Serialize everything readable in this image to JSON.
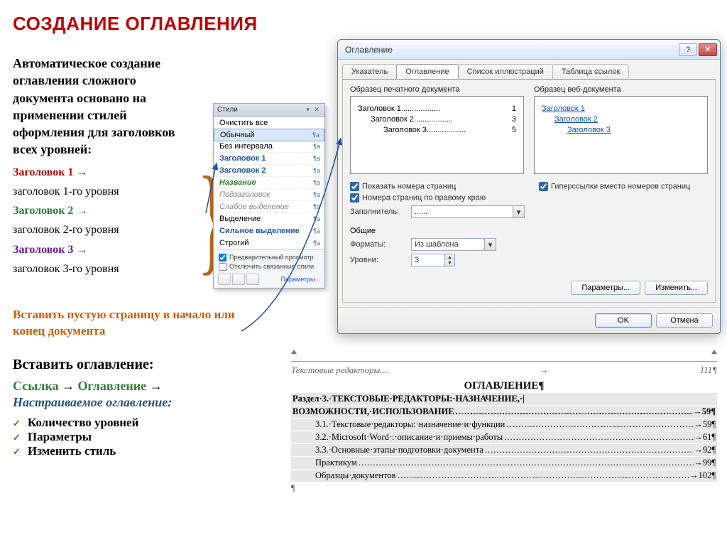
{
  "title": "СОЗДАНИЕ ОГЛАВЛЕНИЯ",
  "intro": "Автоматическое создание оглавления сложного документа основано на применении стилей оформления для заголовков всех уровней:",
  "hlist": {
    "h1": "Заголовок 1 →",
    "h1d": "заголовок 1-го уровня",
    "h2": "Заголовок 2 →",
    "h2d": "заголовок 2-го уровня",
    "h3": "Заголовок 3 →",
    "h3d": "заголовок 3-го уровня"
  },
  "orange": "Вставить пустую страницу  в начало или  конец документа",
  "insert": "Вставить оглавление:",
  "path": {
    "link": "Ссылка",
    "arrow": "→",
    "toc": "Оглавление"
  },
  "custom": "Настраиваемое оглавление:",
  "checks": [
    "Количество уровней",
    "Параметры",
    "Изменить стиль"
  ],
  "stylesPane": {
    "title": "Стили",
    "clear": "Очистить все",
    "rows": [
      {
        "name": "Обычный",
        "cls": "sel"
      },
      {
        "name": "Без интервала",
        "cls": ""
      },
      {
        "name": "Заголовок 1",
        "cls": "blue"
      },
      {
        "name": "Заголовок 2",
        "cls": "blue"
      },
      {
        "name": "Название",
        "cls": "green2"
      },
      {
        "name": "Подзаголовок",
        "cls": "italic-grey"
      },
      {
        "name": "Слабое выделение",
        "cls": "italic-grey"
      },
      {
        "name": "Выделение",
        "cls": ""
      },
      {
        "name": "Сильное выделение",
        "cls": "blue"
      },
      {
        "name": "Строгий",
        "cls": ""
      }
    ],
    "cbPreview": "Предварительный просмотр",
    "cbLinked": "Отключить связанные стили",
    "params": "Параметры..."
  },
  "dialog": {
    "title": "Оглавление",
    "tabs": [
      "Указатель",
      "Оглавление",
      "Список иллюстраций",
      "Таблица ссылок"
    ],
    "printLabel": "Образец печатного документа",
    "webLabel": "Образец веб-документа",
    "print": [
      {
        "t": "Заголовок 1",
        "p": "1",
        "ind": ""
      },
      {
        "t": "Заголовок 2",
        "p": "3",
        "ind": "ind1"
      },
      {
        "t": "Заголовок 3",
        "p": "5",
        "ind": "ind2"
      }
    ],
    "web": [
      "Заголовок 1",
      "Заголовок 2",
      "Заголовок 3"
    ],
    "showPages": "Показать номера страниц",
    "rightAlign": "Номера страниц по правому краю",
    "hyperlinks": "Гиперссылки вместо номеров страниц",
    "fillerLabel": "Заполнитель:",
    "fillerValue": "......",
    "general": "Общие",
    "formatsLabel": "Форматы:",
    "formatsValue": "Из шаблона",
    "levelsLabel": "Уровни:",
    "levelsValue": "3",
    "btnParams": "Параметры...",
    "btnModify": "Изменить...",
    "ok": "OK",
    "cancel": "Отмена"
  },
  "doc": {
    "header": "Текстовые редакторы…",
    "page": "111¶",
    "tocTitle": "ОГЛАВЛЕНИЕ¶",
    "entries": [
      {
        "t": "Раздел·3.·ТЕКСТОВЫЕ·РЕДАКТОРЫ:·НАЗНАЧЕНИЕ,·|",
        "p": "",
        "bold": true,
        "ind": ""
      },
      {
        "t": "ВОЗМОЖНОСТИ,·ИСПОЛЬЗОВАНИЕ",
        "p": "59¶",
        "bold": true,
        "ind": ""
      },
      {
        "t": "3.1.·Текстовые·редакторы:·назначение·и·функции",
        "p": "59¶",
        "bold": false,
        "ind": "lvl2"
      },
      {
        "t": "3.2.·Microsoft·Word·:·описание·и·приемы·работы",
        "p": "61¶",
        "bold": false,
        "ind": "lvl2"
      },
      {
        "t": "3.3.·Основные·этапы·подготовки·документа",
        "p": "92¶",
        "bold": false,
        "ind": "lvl2"
      },
      {
        "t": "Практикум",
        "p": "99¶",
        "bold": false,
        "ind": "lvl2"
      },
      {
        "t": "Образцы·документов",
        "p": "102¶",
        "bold": false,
        "ind": "lvl2"
      }
    ],
    "end": "¶"
  }
}
